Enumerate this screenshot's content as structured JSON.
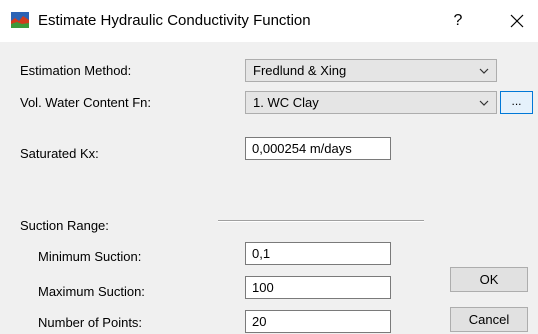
{
  "window": {
    "title": "Estimate Hydraulic Conductivity Function",
    "help_label": "?",
    "icons": {
      "app": "hydraulic-app-icon",
      "close": "close-icon"
    }
  },
  "form": {
    "estimation_method": {
      "label": "Estimation Method:",
      "value": "Fredlund & Xing"
    },
    "vol_water_content": {
      "label": "Vol. Water Content Fn:",
      "value": "1. WC Clay",
      "browse_label": "..."
    },
    "saturated_kx": {
      "label": "Saturated Kx:",
      "value": "0,000254 m/days"
    },
    "suction_range": {
      "label": "Suction Range:",
      "minimum": {
        "label": "Minimum Suction:",
        "value": "0,1"
      },
      "maximum": {
        "label": "Maximum Suction:",
        "value": "100"
      },
      "points": {
        "label": "Number of Points:",
        "value": "20"
      }
    }
  },
  "buttons": {
    "ok": "OK",
    "cancel": "Cancel"
  },
  "colors": {
    "title_bg": "#ffffff",
    "dialog_bg": "#f0f0f0",
    "focus_border": "#0078d7"
  }
}
